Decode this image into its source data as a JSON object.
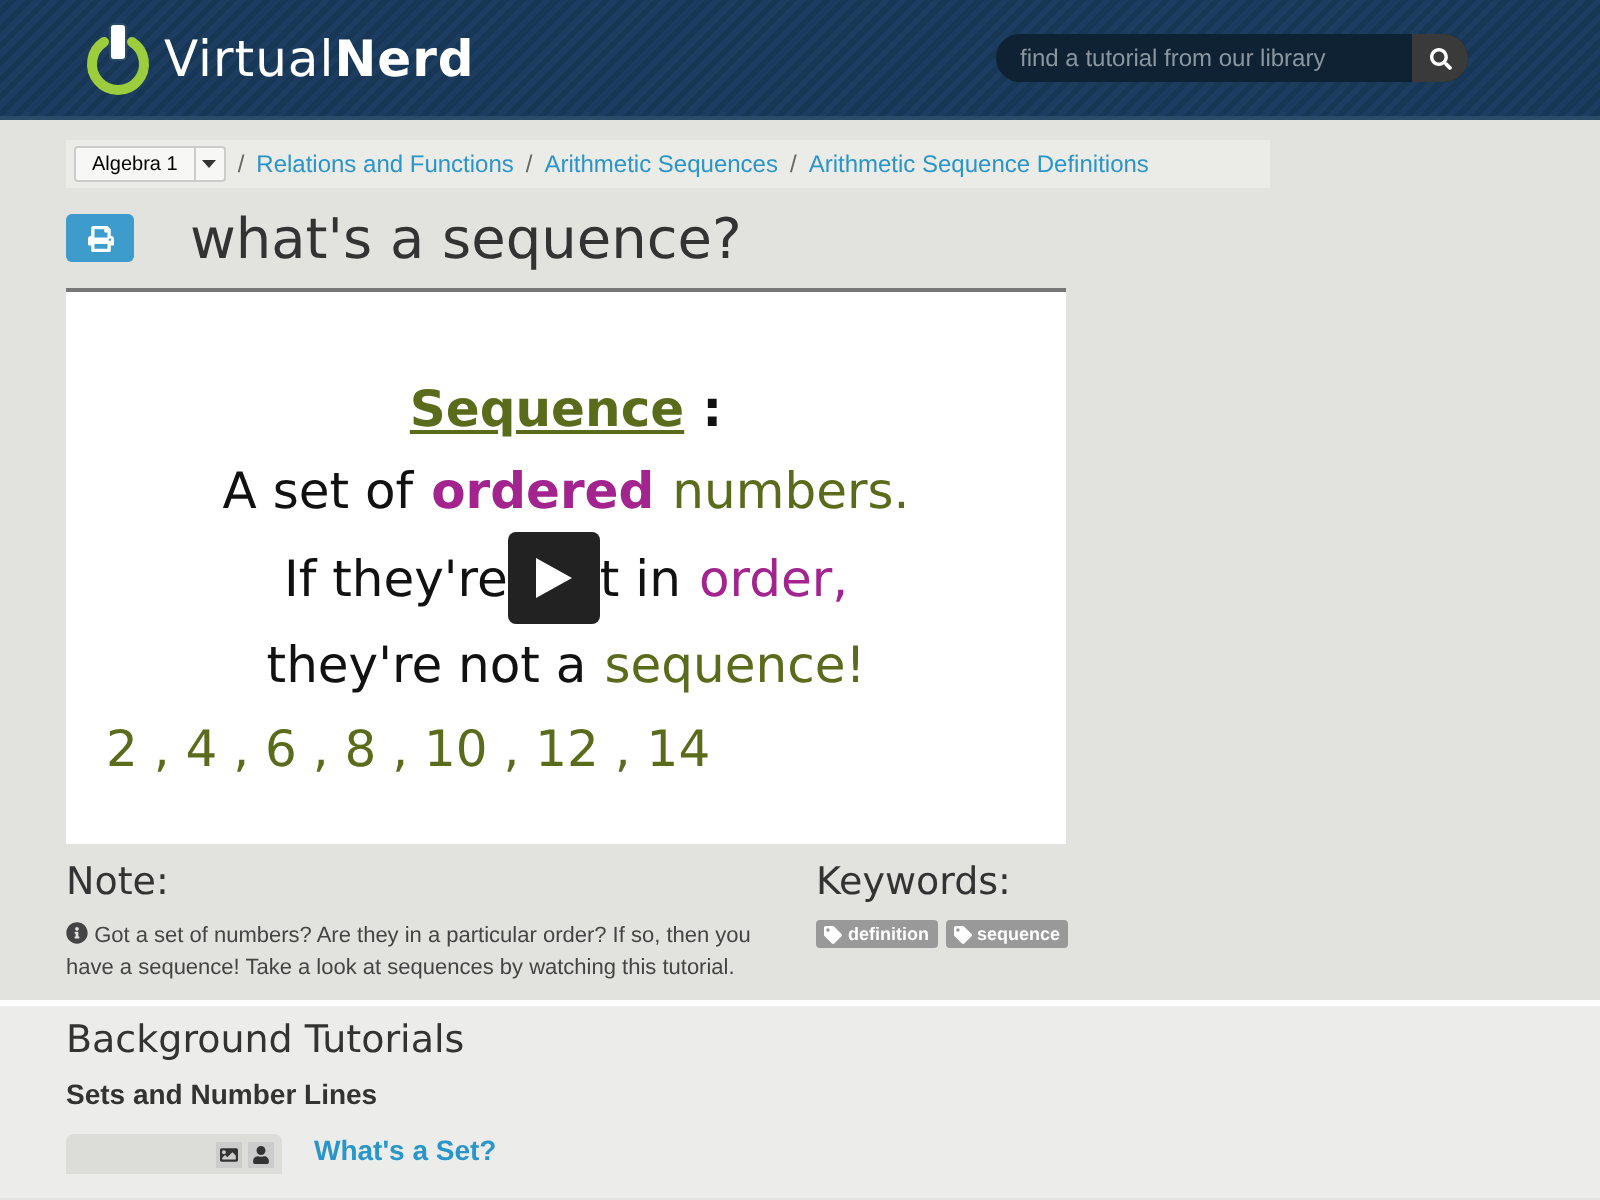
{
  "header": {
    "logo": {
      "light": "Virtual",
      "bold": "Nerd"
    },
    "search": {
      "placeholder": "find a tutorial from our library"
    }
  },
  "breadcrumb": {
    "course": "Algebra 1",
    "separator": "/",
    "links": [
      "Relations and Functions",
      "Arithmetic Sequences",
      "Arithmetic Sequence Definitions"
    ]
  },
  "title": "what's a sequence?",
  "video": {
    "lines": [
      [
        {
          "text": "Sequence",
          "color": "#5a6b1c",
          "bold": true,
          "underline": true
        },
        {
          "text": ":",
          "color": "#111111",
          "bold": true,
          "underline": false
        }
      ],
      [
        {
          "text": "A set of",
          "color": "#111111",
          "bold": false,
          "underline": false
        },
        {
          "text": "ordered",
          "color": "#a3248f",
          "bold": true,
          "underline": false
        },
        {
          "text": "numbers.",
          "color": "#5a6b1c",
          "bold": false,
          "underline": false
        }
      ],
      [
        {
          "text": "If they're",
          "color": "#111111",
          "bold": false,
          "underline": false
        },
        {
          "kind": "play"
        },
        {
          "text": "t in",
          "color": "#111111",
          "bold": false,
          "underline": false
        },
        {
          "text": "order,",
          "color": "#a3248f",
          "bold": false,
          "underline": false
        }
      ],
      [
        {
          "text": "they're not a",
          "color": "#111111",
          "bold": false,
          "underline": false
        },
        {
          "text": "sequence!",
          "color": "#5a6b1c",
          "bold": false,
          "underline": false
        }
      ]
    ],
    "numbers": "2 , 4 , 6 , 8 , 10 , 12 , 14"
  },
  "note": {
    "heading": "Note:",
    "text": "Got a set of numbers? Are they in a particular order? If so, then you have a sequence! Take a look at sequences by watching this tutorial."
  },
  "keywords": {
    "heading": "Keywords:",
    "tags": [
      "definition",
      "sequence"
    ]
  },
  "background": {
    "heading": "Background Tutorials",
    "group": "Sets and Number Lines",
    "tutorials": [
      {
        "title": "What's a Set?"
      }
    ]
  }
}
